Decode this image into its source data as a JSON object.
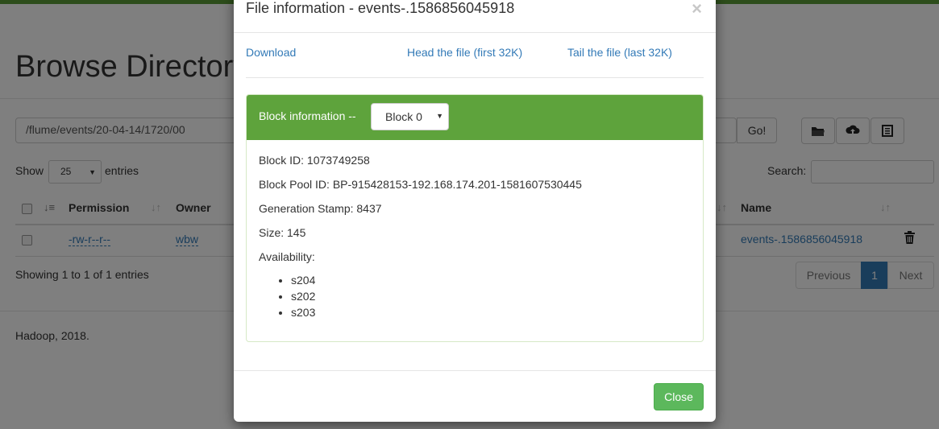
{
  "page": {
    "title": "Browse Directory",
    "path_value": "/flume/events/20-04-14/1720/00",
    "go_label": "Go!",
    "toolbar_icons": [
      "folder-icon",
      "upload-icon",
      "list-icon"
    ],
    "show_label": "Show",
    "show_value": "25",
    "entries_label": "entries",
    "search_label": "Search:",
    "table": {
      "headers": [
        "Permission",
        "Owner",
        "Name"
      ],
      "rows": [
        {
          "permission": "-rw-r--r--",
          "owner": "wbw",
          "name": "events-.1586856045918"
        }
      ]
    },
    "info": "Showing 1 to 1 of 1 entries",
    "pagination": {
      "previous": "Previous",
      "current": "1",
      "next": "Next"
    },
    "footer": "Hadoop, 2018."
  },
  "modal": {
    "title": "File information - events-.1586856045918",
    "close_x": "×",
    "links": {
      "download": "Download",
      "head": "Head the file (first 32K)",
      "tail": "Tail the file (last 32K)"
    },
    "block_label": "Block information --",
    "block_select": "Block 0",
    "block_id": "Block ID: 1073749258",
    "block_pool_id": "Block Pool ID: BP-915428153-192.168.174.201-1581607530445",
    "generation_stamp": "Generation Stamp: 8437",
    "size": "Size: 145",
    "availability_label": "Availability:",
    "availability": [
      "s204",
      "s202",
      "s203"
    ],
    "close_button": "Close"
  },
  "colors": {
    "accent_green": "#5ea33c",
    "link_blue": "#337ab7",
    "button_green": "#5cb85c"
  }
}
